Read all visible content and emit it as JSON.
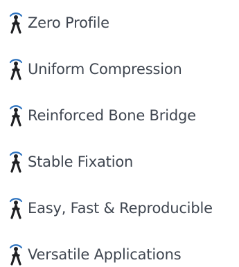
{
  "features": [
    {
      "icon": "person-figure-icon",
      "label": "Zero Profile"
    },
    {
      "icon": "person-figure-icon",
      "label": "Uniform Compression"
    },
    {
      "icon": "person-figure-icon",
      "label": "Reinforced Bone Bridge"
    },
    {
      "icon": "person-figure-icon",
      "label": "Stable Fixation"
    },
    {
      "icon": "person-figure-icon",
      "label": "Easy, Fast & Reproducible"
    },
    {
      "icon": "person-figure-icon",
      "label": "Versatile Applications"
    }
  ],
  "colors": {
    "icon_dark": "#1f2023",
    "icon_accent": "#2f74c0",
    "text": "#3f4650"
  }
}
